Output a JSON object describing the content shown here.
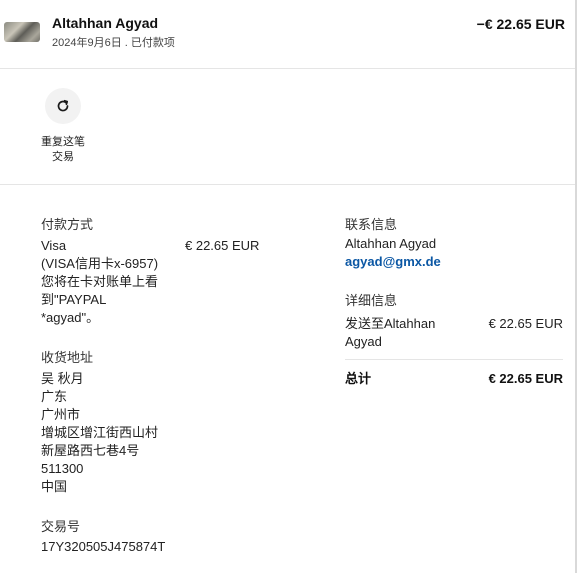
{
  "header": {
    "merchant": "Altahhan Agyad",
    "date_status": "2024年9月6日 . 已付款项",
    "amount": "−€ 22.65 EUR"
  },
  "actions": {
    "repeat_label_line1": "重复这笔",
    "repeat_label_line2": "交易"
  },
  "payment": {
    "title": "付款方式",
    "method_lines": [
      "Visa",
      "(VISA信用卡x-6957)",
      "您将在卡对账单上看",
      "到\"PAYPAL",
      "*agyad\"。"
    ],
    "amount": "€ 22.65 EUR"
  },
  "shipping": {
    "title": "收货地址",
    "lines": [
      "吴 秋月",
      "广东",
      "广州市",
      "增城区增江街西山村",
      "新屋路西七巷4号",
      "511300",
      "中国"
    ]
  },
  "transaction": {
    "title": "交易号",
    "id": "17Y320505J475874T"
  },
  "contact": {
    "title": "联系信息",
    "name": "Altahhan Agyad",
    "email": "agyad@gmx.de"
  },
  "details": {
    "title": "详细信息",
    "sent_line1": "发送至Altahhan",
    "sent_line2": "Agyad",
    "sent_amount": "€ 22.65 EUR",
    "total_label": "总计",
    "total_amount": "€ 22.65 EUR"
  }
}
